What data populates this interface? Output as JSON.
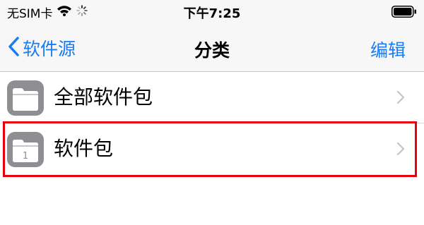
{
  "status_bar": {
    "carrier": "无SIM卡",
    "time": "下午7:25",
    "icons": [
      "wifi-icon",
      "activity-spinner-icon",
      "battery-icon"
    ]
  },
  "nav": {
    "back_label": "软件源",
    "title": "分类",
    "edit_label": "编辑",
    "accent_color": "#1a7cf5"
  },
  "list": {
    "items": [
      {
        "label": "全部软件包",
        "icon": "folder-icon",
        "badge": ""
      },
      {
        "label": "软件包",
        "icon": "folder-icon",
        "badge": "1"
      }
    ]
  },
  "highlight_color": "#e8000b"
}
